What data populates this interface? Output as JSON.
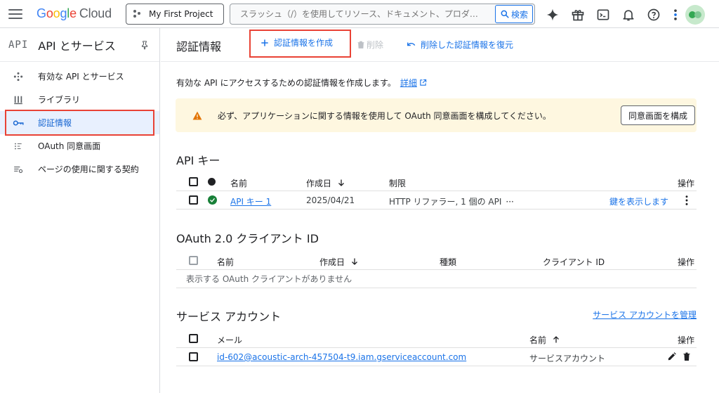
{
  "topbar": {
    "logo_g": "G",
    "logo_o1": "o",
    "logo_o2": "o",
    "logo_g2": "g",
    "logo_l": "l",
    "logo_e": "e",
    "logo_cloud": "Cloud",
    "project": "My First Project",
    "search_placeholder": "スラッシュ（/）を使用してリソース、ドキュメント、プロダ…",
    "search_button": "検索"
  },
  "sidebar": {
    "logo": "API",
    "title": "API とサービス",
    "items": [
      {
        "label": "有効な API とサービス",
        "icon": "api-diamond-icon"
      },
      {
        "label": "ライブラリ",
        "icon": "library-icon"
      },
      {
        "label": "認証情報",
        "icon": "key-icon"
      },
      {
        "label": "OAuth 同意画面",
        "icon": "consent-icon"
      },
      {
        "label": "ページの使用に関する契約",
        "icon": "settings-list-icon"
      }
    ]
  },
  "main": {
    "title": "認証情報",
    "create_label": "認証情報を作成",
    "delete_label": "削除",
    "restore_label": "削除した認証情報を復元",
    "intro_text": "有効な API にアクセスするための認証情報を作成します。",
    "intro_link": "詳細",
    "banner_text": "必ず、アプリケーションに関する情報を使用して OAuth 同意画面を構成してください。",
    "banner_button": "同意画面を構成"
  },
  "api_keys": {
    "title": "API キー",
    "headers": {
      "name": "名前",
      "created": "作成日",
      "restrictions": "制限",
      "actions": "操作"
    },
    "rows": [
      {
        "name": "API キー 1",
        "created": "2025/04/21",
        "restrictions": "HTTP リファラー, 1 個の API",
        "more": "···",
        "show_key": "鍵を表示します"
      }
    ]
  },
  "oauth": {
    "title": "OAuth 2.0 クライアント ID",
    "headers": {
      "name": "名前",
      "created": "作成日",
      "type": "種類",
      "client_id": "クライアント ID",
      "actions": "操作"
    },
    "empty": "表示する OAuth クライアントがありません"
  },
  "service_accounts": {
    "title": "サービス アカウント",
    "manage_link": "サービス アカウントを管理",
    "headers": {
      "email": "メール",
      "name": "名前",
      "actions": "操作"
    },
    "rows": [
      {
        "email": "id-602@acoustic-arch-457504-t9.iam.gserviceaccount.com",
        "name": "サービスアカウント"
      }
    ]
  },
  "colors": {
    "accent": "#1a73e8",
    "highlight": "#e94235",
    "warning": "#e37400",
    "success": "#188038"
  }
}
